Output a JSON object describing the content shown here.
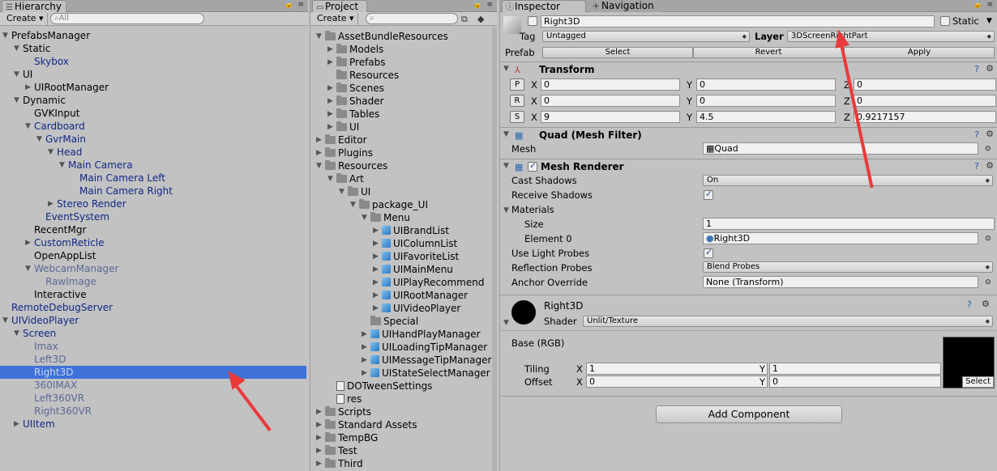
{
  "hierarchy": {
    "tab": "Hierarchy",
    "create": "Create ▾",
    "search_placeholder": "All",
    "items": [
      {
        "label": "PrefabsManager",
        "depth": 0,
        "arrow": "open",
        "color": "normal"
      },
      {
        "label": "Static",
        "depth": 1,
        "arrow": "open",
        "color": "normal"
      },
      {
        "label": "Skybox",
        "depth": 2,
        "arrow": "none",
        "color": "blue"
      },
      {
        "label": "UI",
        "depth": 1,
        "arrow": "open",
        "color": "normal"
      },
      {
        "label": "UIRootManager",
        "depth": 2,
        "arrow": "closed",
        "color": "normal"
      },
      {
        "label": "Dynamic",
        "depth": 1,
        "arrow": "open",
        "color": "normal"
      },
      {
        "label": "GVKInput",
        "depth": 2,
        "arrow": "none",
        "color": "normal"
      },
      {
        "label": "Cardboard",
        "depth": 2,
        "arrow": "open",
        "color": "blue"
      },
      {
        "label": "GvrMain",
        "depth": 3,
        "arrow": "open",
        "color": "blue"
      },
      {
        "label": "Head",
        "depth": 4,
        "arrow": "open",
        "color": "blue"
      },
      {
        "label": "Main Camera",
        "depth": 5,
        "arrow": "open",
        "color": "blue"
      },
      {
        "label": "Main Camera Left",
        "depth": 6,
        "arrow": "none",
        "color": "blue"
      },
      {
        "label": "Main Camera Right",
        "depth": 6,
        "arrow": "none",
        "color": "blue"
      },
      {
        "label": "Stereo Render",
        "depth": 4,
        "arrow": "closed",
        "color": "blue"
      },
      {
        "label": "EventSystem",
        "depth": 3,
        "arrow": "none",
        "color": "blue"
      },
      {
        "label": "RecentMgr",
        "depth": 2,
        "arrow": "none",
        "color": "normal"
      },
      {
        "label": "CustomReticle",
        "depth": 2,
        "arrow": "closed",
        "color": "blue"
      },
      {
        "label": "OpenAppList",
        "depth": 2,
        "arrow": "none",
        "color": "normal"
      },
      {
        "label": "WebcamManager",
        "depth": 2,
        "arrow": "open",
        "color": "grey"
      },
      {
        "label": "RawImage",
        "depth": 3,
        "arrow": "none",
        "color": "grey"
      },
      {
        "label": "Interactive",
        "depth": 2,
        "arrow": "none",
        "color": "normal"
      },
      {
        "label": "RemoteDebugServer",
        "depth": 0,
        "arrow": "none",
        "color": "blue"
      },
      {
        "label": "UIVideoPlayer",
        "depth": 0,
        "arrow": "open",
        "color": "blue"
      },
      {
        "label": "Screen",
        "depth": 1,
        "arrow": "open",
        "color": "blue"
      },
      {
        "label": "Imax",
        "depth": 2,
        "arrow": "none",
        "color": "grey"
      },
      {
        "label": "Left3D",
        "depth": 2,
        "arrow": "none",
        "color": "grey"
      },
      {
        "label": "Right3D",
        "depth": 2,
        "arrow": "none",
        "color": "selected"
      },
      {
        "label": "360IMAX",
        "depth": 2,
        "arrow": "none",
        "color": "grey"
      },
      {
        "label": "Left360VR",
        "depth": 2,
        "arrow": "none",
        "color": "grey"
      },
      {
        "label": "Right360VR",
        "depth": 2,
        "arrow": "none",
        "color": "grey"
      },
      {
        "label": "UIItem",
        "depth": 1,
        "arrow": "closed",
        "color": "blue"
      }
    ]
  },
  "project": {
    "tab": "Project",
    "create": "Create ▾",
    "items": [
      {
        "label": "AssetBundleResources",
        "depth": 0,
        "arrow": "open",
        "icon": "folder"
      },
      {
        "label": "Models",
        "depth": 1,
        "arrow": "closed",
        "icon": "folder"
      },
      {
        "label": "Prefabs",
        "depth": 1,
        "arrow": "closed",
        "icon": "folder"
      },
      {
        "label": "Resources",
        "depth": 1,
        "arrow": "none",
        "icon": "folder"
      },
      {
        "label": "Scenes",
        "depth": 1,
        "arrow": "closed",
        "icon": "folder"
      },
      {
        "label": "Shader",
        "depth": 1,
        "arrow": "closed",
        "icon": "folder"
      },
      {
        "label": "Tables",
        "depth": 1,
        "arrow": "closed",
        "icon": "folder"
      },
      {
        "label": "UI",
        "depth": 1,
        "arrow": "closed",
        "icon": "folder"
      },
      {
        "label": "Editor",
        "depth": 0,
        "arrow": "closed",
        "icon": "folder"
      },
      {
        "label": "Plugins",
        "depth": 0,
        "arrow": "closed",
        "icon": "folder"
      },
      {
        "label": "Resources",
        "depth": 0,
        "arrow": "open",
        "icon": "folder"
      },
      {
        "label": "Art",
        "depth": 1,
        "arrow": "open",
        "icon": "folder"
      },
      {
        "label": "UI",
        "depth": 2,
        "arrow": "open",
        "icon": "folder"
      },
      {
        "label": "package_UI",
        "depth": 3,
        "arrow": "open",
        "icon": "folder"
      },
      {
        "label": "Menu",
        "depth": 4,
        "arrow": "open",
        "icon": "folder"
      },
      {
        "label": "UIBrandList",
        "depth": 5,
        "arrow": "closed",
        "icon": "cube"
      },
      {
        "label": "UIColumnList",
        "depth": 5,
        "arrow": "closed",
        "icon": "cube"
      },
      {
        "label": "UIFavoriteList",
        "depth": 5,
        "arrow": "closed",
        "icon": "cube"
      },
      {
        "label": "UIMainMenu",
        "depth": 5,
        "arrow": "closed",
        "icon": "cube"
      },
      {
        "label": "UIPlayRecommend",
        "depth": 5,
        "arrow": "closed",
        "icon": "cube"
      },
      {
        "label": "UIRootManager",
        "depth": 5,
        "arrow": "closed",
        "icon": "cube"
      },
      {
        "label": "UIVideoPlayer",
        "depth": 5,
        "arrow": "closed",
        "icon": "cube"
      },
      {
        "label": "Special",
        "depth": 4,
        "arrow": "none",
        "icon": "folder"
      },
      {
        "label": "UIHandPlayManager",
        "depth": 4,
        "arrow": "closed",
        "icon": "cube"
      },
      {
        "label": "UILoadingTipManager",
        "depth": 4,
        "arrow": "closed",
        "icon": "cube"
      },
      {
        "label": "UIMessageTipManager",
        "depth": 4,
        "arrow": "closed",
        "icon": "cube"
      },
      {
        "label": "UIStateSelectManager",
        "depth": 4,
        "arrow": "closed",
        "icon": "cube"
      },
      {
        "label": "DOTweenSettings",
        "depth": 1,
        "arrow": "none",
        "icon": "doc"
      },
      {
        "label": "res",
        "depth": 1,
        "arrow": "none",
        "icon": "doc"
      },
      {
        "label": "Scripts",
        "depth": 0,
        "arrow": "closed",
        "icon": "folder"
      },
      {
        "label": "Standard Assets",
        "depth": 0,
        "arrow": "closed",
        "icon": "folder"
      },
      {
        "label": "TempBG",
        "depth": 0,
        "arrow": "closed",
        "icon": "folder"
      },
      {
        "label": "Test",
        "depth": 0,
        "arrow": "closed",
        "icon": "folder"
      },
      {
        "label": "Third",
        "depth": 0,
        "arrow": "closed",
        "icon": "folder"
      }
    ]
  },
  "inspector": {
    "tab": "Inspector",
    "tab2": "Navigation",
    "name": "Right3D",
    "static_label": "Static",
    "tag_label": "Tag",
    "tag_value": "Untagged",
    "layer_label": "Layer",
    "layer_value": "3DScreenRightPart",
    "prefab_label": "Prefab",
    "prefab_select": "Select",
    "prefab_revert": "Revert",
    "prefab_apply": "Apply",
    "transform": {
      "title": "Transform",
      "p": "P",
      "r": "R",
      "s": "S",
      "x": "X",
      "y": "Y",
      "z": "Z",
      "pos": [
        "0",
        "0",
        "0"
      ],
      "rot": [
        "0",
        "0",
        "0"
      ],
      "scale": [
        "9",
        "4.5",
        "0.9217157"
      ]
    },
    "meshfilter": {
      "title": "Quad (Mesh Filter)",
      "mesh_label": "Mesh",
      "mesh_value": "Quad"
    },
    "renderer": {
      "title": "Mesh Renderer",
      "cast_label": "Cast Shadows",
      "cast_value": "On",
      "receive_label": "Receive Shadows",
      "materials_label": "Materials",
      "size_label": "Size",
      "size_value": "1",
      "element_label": "Element 0",
      "element_value": "Right3D",
      "lightprobes_label": "Use Light Probes",
      "reflection_label": "Reflection Probes",
      "reflection_value": "Blend Probes",
      "anchor_label": "Anchor Override",
      "anchor_value": "None (Transform)"
    },
    "material": {
      "name": "Right3D",
      "shader_label": "Shader",
      "shader_value": "Unlit/Texture",
      "base_label": "Base (RGB)",
      "tiling_label": "Tiling",
      "offset_label": "Offset",
      "tiling": [
        "1",
        "1"
      ],
      "offset": [
        "0",
        "0"
      ],
      "select": "Select"
    },
    "add_component": "Add Component"
  }
}
